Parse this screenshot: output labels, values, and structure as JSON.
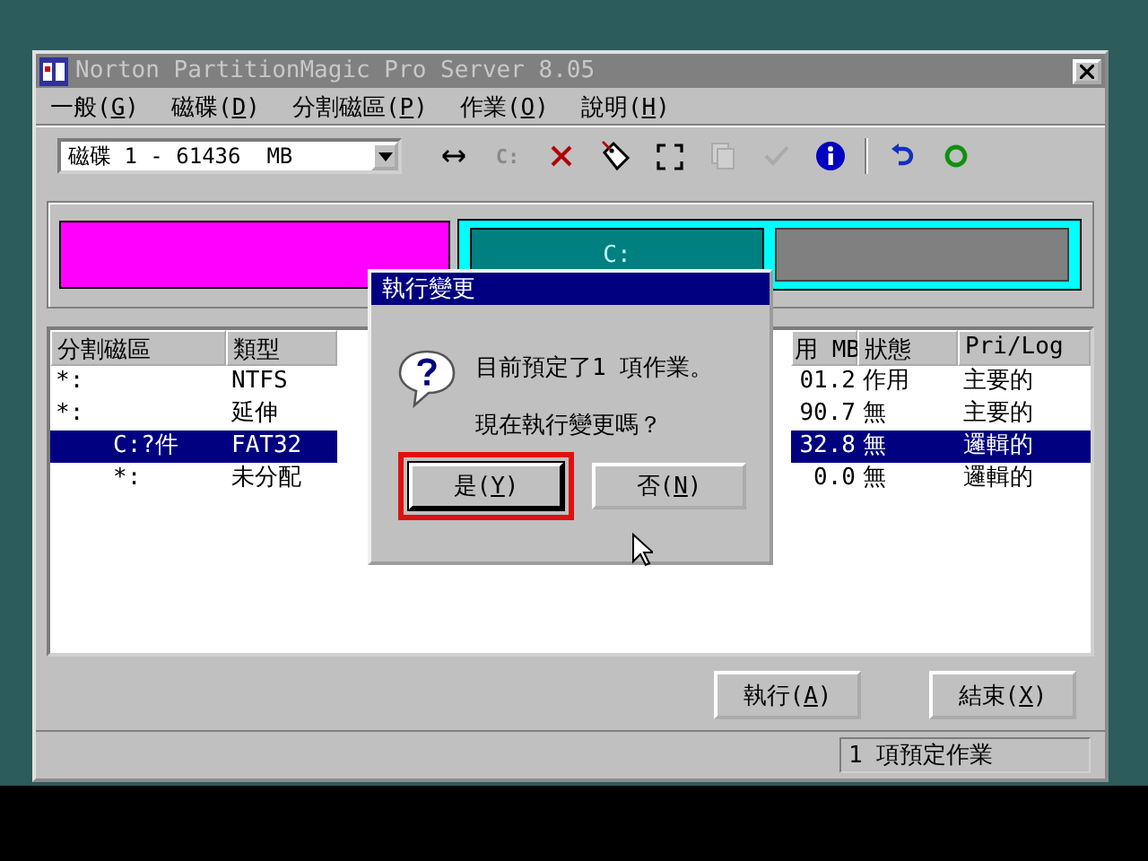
{
  "window": {
    "title": "Norton PartitionMagic Pro Server 8.05"
  },
  "menu": [
    {
      "label": "一般(",
      "key": "G",
      "tail": ")"
    },
    {
      "label": "磁碟(",
      "key": "D",
      "tail": ")"
    },
    {
      "label": "分割磁區(",
      "key": "P",
      "tail": ")"
    },
    {
      "label": "作業(",
      "key": "O",
      "tail": ")"
    },
    {
      "label": "說明(",
      "key": "H",
      "tail": ")"
    }
  ],
  "disk_select": {
    "value": "磁碟 1 - 61436  MB"
  },
  "toolbar_groups": [
    {
      "items": [
        {
          "kind": "resize",
          "disabled": false
        },
        {
          "kind": "drive",
          "label": "C:",
          "disabled": true
        },
        {
          "kind": "delete",
          "disabled": false
        },
        {
          "kind": "tag",
          "disabled": false
        },
        {
          "kind": "frame",
          "disabled": false
        },
        {
          "kind": "copy",
          "disabled": true
        },
        {
          "kind": "check",
          "disabled": true
        },
        {
          "kind": "info",
          "disabled": false
        }
      ]
    },
    {
      "items": [
        {
          "kind": "undo",
          "disabled": false
        },
        {
          "kind": "apply",
          "disabled": false
        }
      ]
    }
  ],
  "disk_map": [
    {
      "kind": "primary",
      "color": "#ff00ff"
    },
    {
      "kind": "extended",
      "color": "#00ffff",
      "children": [
        {
          "label": "C:",
          "color": "#008080",
          "selected": true
        },
        {
          "color": "#808080",
          "selected": false
        }
      ]
    }
  ],
  "table": {
    "columns": [
      "分割磁區",
      "類型",
      "用 MB",
      "狀態",
      "Pri/Log"
    ],
    "rows": [
      {
        "partition": "*:",
        "type": "NTFS",
        "column_3": "01.2",
        "status": "作用",
        "pri_log": "主要的",
        "selected": false
      },
      {
        "partition": "*:",
        "type": "延伸",
        "column_3": "90.7",
        "status": "無",
        "pri_log": "主要的",
        "selected": false,
        "children": [
          {
            "partition": "C:?件",
            "type": "FAT32",
            "column_3": "32.8",
            "status": "無",
            "pri_log": "邏輯的",
            "selected": true
          },
          {
            "partition": "*:",
            "type": "未分配",
            "column_3": "0.0",
            "status": "無",
            "pri_log": "邏輯的",
            "selected": false
          }
        ]
      }
    ]
  },
  "buttons": [
    {
      "label": "執行(",
      "key": "A",
      "tail": ")"
    },
    {
      "label": "結束(",
      "key": "X",
      "tail": ")"
    }
  ],
  "status_bar": "1 項預定作業",
  "dialog": {
    "title": "執行變更",
    "message": "目前預定了1 項作業。",
    "question": "現在執行變更嗎？",
    "buttons": [
      {
        "label": "是(",
        "key": "Y",
        "tail": ")",
        "highlighted": true
      },
      {
        "label": "否(",
        "key": "N",
        "tail": ")",
        "highlighted": false
      }
    ]
  }
}
